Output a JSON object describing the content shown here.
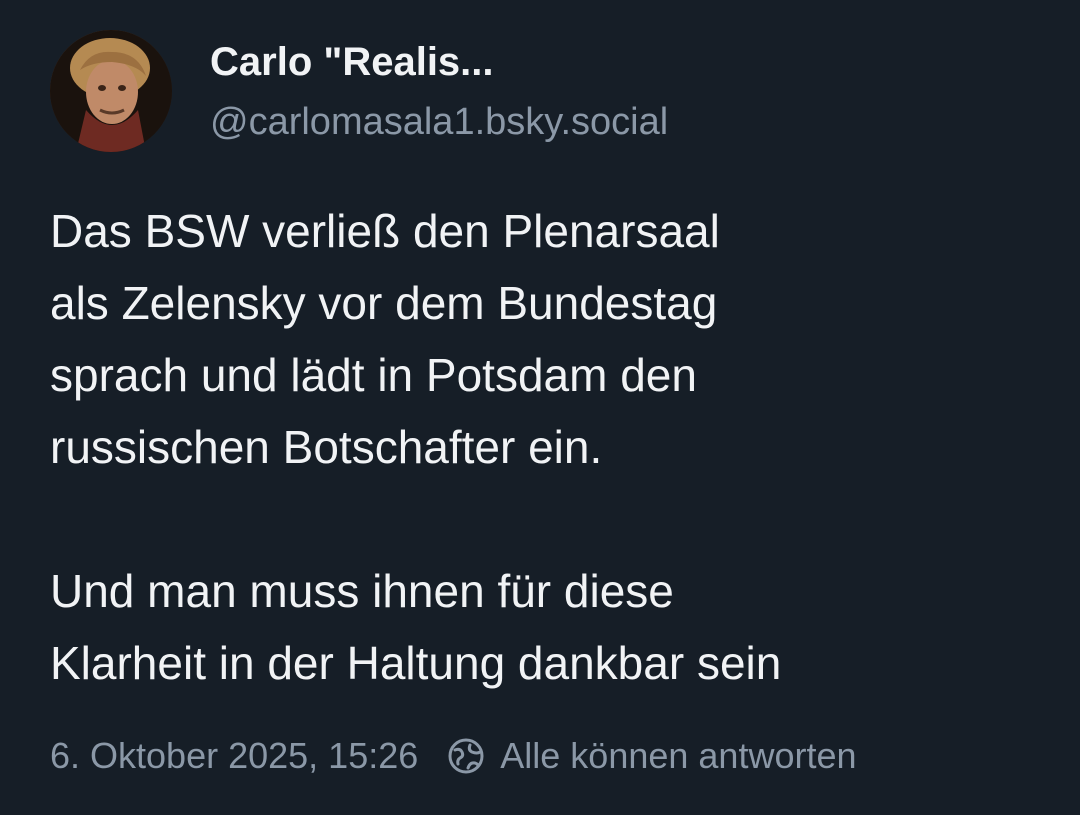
{
  "post": {
    "author_name": "Carlo \"Realis...",
    "author_handle": "@carlomasala1.bsky.social",
    "text_lines": [
      "Das BSW verließ den Plenarsaal",
      "als Zelensky vor dem Bundestag",
      "sprach und lädt in Potsdam den",
      "russischen Botschafter ein."
    ],
    "text_lines_2": [
      "Und man muss ihnen für diese",
      "Klarheit in der Haltung dankbar sein"
    ],
    "timestamp": "6. Oktober 2025, 15:26",
    "reply_setting": "Alle können antworten",
    "reply_icon": "globe-icon"
  },
  "colors": {
    "background": "#161e27",
    "text": "#f1f3f5",
    "muted": "#8b98a7"
  }
}
